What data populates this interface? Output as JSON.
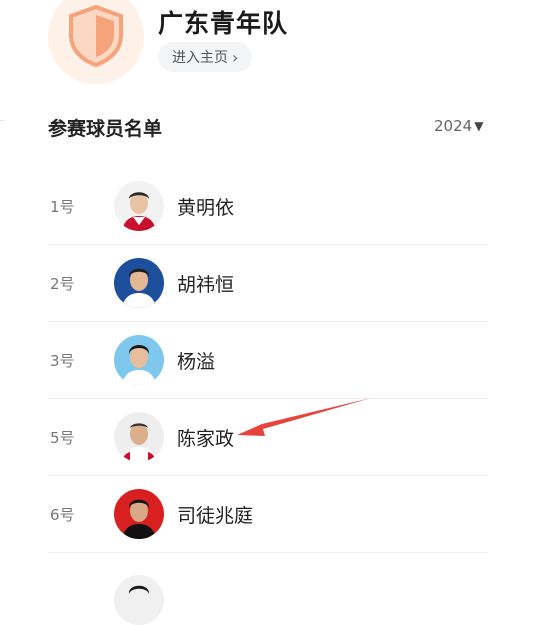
{
  "team": {
    "name": "广东青年队",
    "home_button_label": "进入主页",
    "home_button_icon": "chevron-right-icon",
    "logo_icon": "shield-icon",
    "logo_color": "#f4a37b"
  },
  "roster": {
    "title": "参赛球员名单",
    "year": "2024",
    "year_icon": "caret-down-icon",
    "players": [
      {
        "number": "1号",
        "name": "黄明依",
        "jersey_color": "#c8102e"
      },
      {
        "number": "2号",
        "name": "胡祎恒",
        "jersey_color": "#ffffff",
        "bg_color": "#1d4f9c"
      },
      {
        "number": "3号",
        "name": "杨溢",
        "jersey_color": "#ffffff",
        "bg_color": "#7ec8ee"
      },
      {
        "number": "5号",
        "name": "陈家政",
        "jersey_color": "#c8102e"
      },
      {
        "number": "6号",
        "name": "司徒兆庭",
        "jersey_color": "#111111",
        "bg_color": "#d7201f"
      }
    ]
  },
  "annotation": {
    "arrow_color": "#e8433b",
    "arrow_target": "陈家政"
  }
}
